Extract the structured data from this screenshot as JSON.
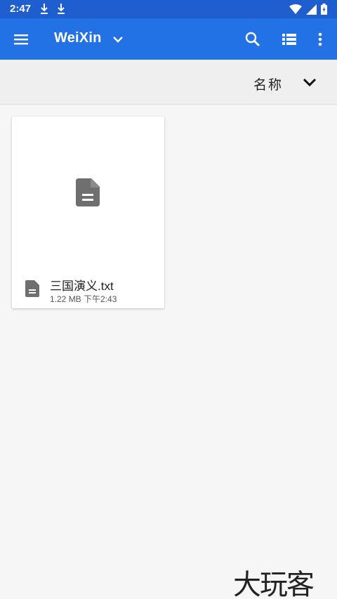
{
  "status_bar": {
    "time": "2:47",
    "icons": [
      "download-icon",
      "download-icon",
      "wifi-icon",
      "signal-icon",
      "battery-icon"
    ]
  },
  "app_bar": {
    "title": "WeiXin",
    "icons": [
      "menu-icon",
      "chevron-down-icon",
      "search-icon",
      "list-view-icon",
      "more-vert-icon"
    ]
  },
  "sort_bar": {
    "label": "名称"
  },
  "files": [
    {
      "name": "三国演义.txt",
      "meta": "1.22 MB 下午2:43",
      "icon": "text-file-icon"
    }
  ],
  "watermark": "大玩客",
  "colors": {
    "status_bar": "#1e5ecf",
    "app_bar": "#2272e6",
    "background": "#f6f6f6",
    "icon_gray": "#6f6f6f"
  }
}
